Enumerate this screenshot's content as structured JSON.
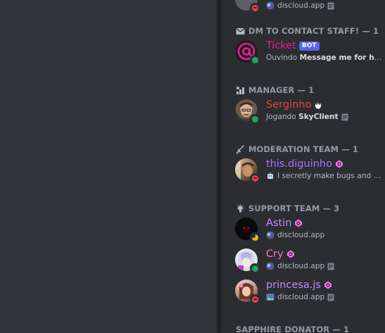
{
  "colors": {
    "role_contact": "#e91e8f",
    "role_manager": "#ed4245",
    "role_moderation": "#a974ff",
    "role_support": "#c58bff",
    "role_support_pink": "#ff73c4",
    "header": "#949ba4"
  },
  "top_partial": {
    "activity": "discloud.app"
  },
  "groups": [
    {
      "header": "DM TO CONTACT STAFF! — 1",
      "icon": "mail-icon",
      "members": [
        {
          "name": "Ticket",
          "tag": "BOT",
          "status": "online",
          "activity_prefix": "Ouvindo",
          "activity_bold": "Message me for help!",
          "avatar": "at-sign-avatar"
        }
      ]
    },
    {
      "header": "MANAGER — 1",
      "icon": "manager-icon",
      "members": [
        {
          "name": "Serginho",
          "status": "online",
          "badge_icon": "penguin-icon",
          "activity_prefix": "Jogando",
          "activity_bold": "SkyClient",
          "avatar": "photo-avatar"
        }
      ]
    },
    {
      "header": "MODERATION TEAM — 1",
      "icon": "sword-icon",
      "members": [
        {
          "name": "this.diguinho",
          "status": "dnd",
          "activity_text": "I secretly make bugs and br...",
          "avatar": "photo-avatar"
        }
      ]
    },
    {
      "header": "SUPPORT TEAM — 3",
      "icon": "bulb-icon",
      "members": [
        {
          "name": "Astin",
          "status": "idle",
          "activity_text": "discloud.app",
          "avatar": "dark-avatar"
        },
        {
          "name": "Cry",
          "status": "online",
          "activity_text": "discloud.app",
          "avatar": "anime-avatar"
        },
        {
          "name": "princesa.js",
          "status": "dnd",
          "activity_text": "discloud.app",
          "avatar": "photo-avatar"
        }
      ]
    },
    {
      "header": "SAPPHIRE DONATOR — 1"
    }
  ]
}
